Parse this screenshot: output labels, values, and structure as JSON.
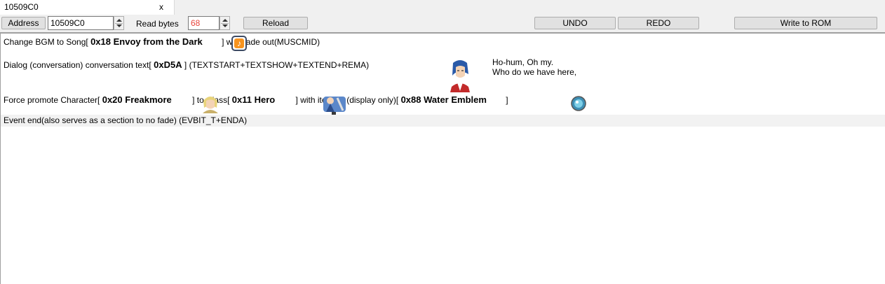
{
  "tab": {
    "title": "10509C0",
    "close": "x"
  },
  "toolbar": {
    "address_label": "Address",
    "address_value": "10509C0",
    "read_bytes_label": "Read bytes",
    "read_bytes_value": "68",
    "reload_label": "Reload",
    "undo_label": "UNDO",
    "redo_label": "REDO",
    "write_label": "Write to ROM"
  },
  "rows": [
    {
      "pre": "Change BGM to  Song[ ",
      "token": "0x18  Envoy from the Dark",
      "post": " ]  with fade out(MUSCMID)",
      "icon": "music-note-icon"
    },
    {
      "pre": "Dialog (conversation) conversation text[ ",
      "token": "0xD5A",
      "post": " ] (TEXTSTART+TEXTSHOW+TEXTEND+REMA)",
      "dialog_line1": "Ho-hum, Oh my.",
      "dialog_line2": "Who do we have here,",
      "icon": "character-portrait-icon"
    },
    {
      "pre": "Force promote  Character[ ",
      "token1": "0x20  Freakmore",
      "mid1": " ] to Class[ ",
      "token2": "0x11  Hero",
      "mid2": " ] with item ID (display only)[ ",
      "token3": "0x88  Water Emblem",
      "post": "  ]",
      "icons": [
        "character-face-icon",
        "hero-class-icon",
        "water-emblem-icon"
      ]
    },
    {
      "text": "Event end(also serves as a section to no fade)  (EVBIT_T+ENDA)"
    }
  ],
  "colors": {
    "read_bytes_value": "#e8453c",
    "note_icon": "#f7931e",
    "portrait_hair": "#2a5aa8"
  }
}
